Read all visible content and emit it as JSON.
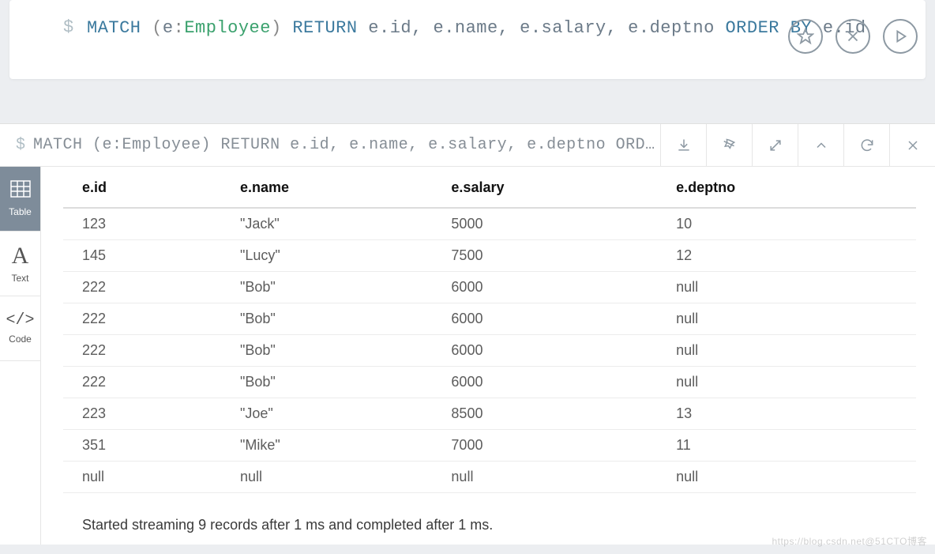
{
  "query": {
    "prompt_symbol": "$",
    "tokens": {
      "match": "MATCH",
      "open_paren": "(",
      "var_e": "e",
      "colon": ":",
      "label": "Employee",
      "close_paren": ")",
      "return": "RETURN",
      "e_id": "e",
      "dot": ".",
      "id": "id",
      "comma": ",",
      "name": "name",
      "salary": "salary",
      "deptno": "deptno",
      "order_by": "ORDER BY"
    }
  },
  "top_icons": {
    "star": "star-icon",
    "close": "close-icon",
    "play": "play-icon"
  },
  "results_header": {
    "prompt": "$",
    "echo": "MATCH (e:Employee) RETURN e.id, e.name, e.salary, e.deptno ORDER BY e.…",
    "actions": {
      "download": "download",
      "pin": "pin",
      "fullscreen": "fullscreen",
      "collapse": "collapse",
      "refresh": "refresh",
      "close": "close"
    }
  },
  "sidebar": {
    "items": [
      {
        "key": "table",
        "label": "Table",
        "icon": "⊞",
        "active": true
      },
      {
        "key": "text",
        "label": "Text",
        "icon": "A",
        "active": false
      },
      {
        "key": "code",
        "label": "Code",
        "icon": "</>",
        "active": false
      }
    ]
  },
  "table": {
    "columns": [
      "e.id",
      "e.name",
      "e.salary",
      "e.deptno"
    ],
    "rows": [
      [
        "123",
        "\"Jack\"",
        "5000",
        "10"
      ],
      [
        "145",
        "\"Lucy\"",
        "7500",
        "12"
      ],
      [
        "222",
        "\"Bob\"",
        "6000",
        "null"
      ],
      [
        "222",
        "\"Bob\"",
        "6000",
        "null"
      ],
      [
        "222",
        "\"Bob\"",
        "6000",
        "null"
      ],
      [
        "222",
        "\"Bob\"",
        "6000",
        "null"
      ],
      [
        "223",
        "\"Joe\"",
        "8500",
        "13"
      ],
      [
        "351",
        "\"Mike\"",
        "7000",
        "11"
      ],
      [
        "null",
        "null",
        "null",
        "null"
      ]
    ]
  },
  "footer": {
    "message": "Started streaming 9 records after 1 ms and completed after 1 ms."
  },
  "watermark": "https://blog.csdn.net@51CTO博客"
}
